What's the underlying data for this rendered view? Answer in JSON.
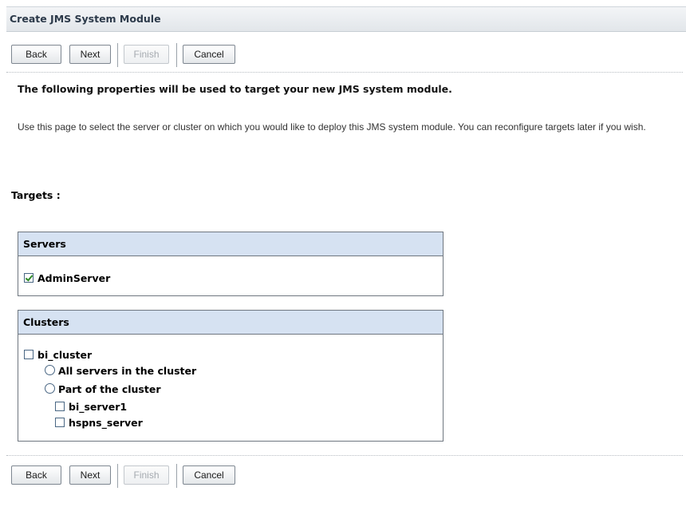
{
  "window": {
    "title": "Create JMS System Module"
  },
  "toolbar": {
    "back_label": "Back",
    "next_label": "Next",
    "finish_label": "Finish",
    "cancel_label": "Cancel"
  },
  "intro": {
    "heading": "The following properties will be used to target your new JMS system module.",
    "description": "Use this page to select the server or cluster on which you would like to deploy this JMS system module. You can reconfigure targets later if you wish."
  },
  "targets": {
    "label": "Targets :",
    "servers": {
      "header": "Servers",
      "items": [
        {
          "label": "AdminServer",
          "checked": true
        }
      ]
    },
    "clusters": {
      "header": "Clusters",
      "cluster": {
        "label": "bi_cluster",
        "checked": false
      },
      "options": [
        {
          "label": "All servers in the cluster",
          "selected": false
        },
        {
          "label": "Part of the cluster",
          "selected": false
        }
      ],
      "members": [
        {
          "label": "bi_server1",
          "checked": false
        },
        {
          "label": "hspns_server",
          "checked": false
        }
      ]
    }
  },
  "colors": {
    "panel_header_bg": "#d6e2f2",
    "check_mark": "#2d8a25",
    "disabled_text": "#a5aab0"
  }
}
